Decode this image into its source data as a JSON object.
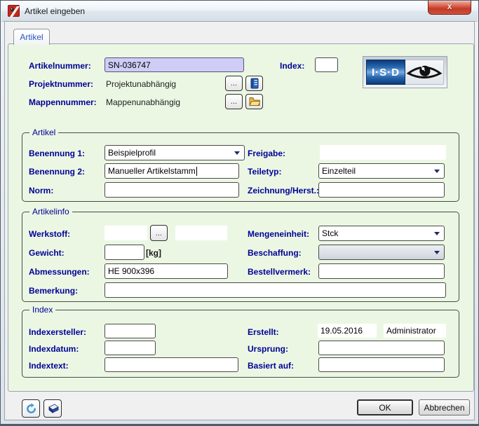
{
  "window": {
    "title": "Artikel eingeben",
    "close": "x"
  },
  "tabs": {
    "artikel": "Artikel"
  },
  "head": {
    "artikelnummer": {
      "label": "Artikelnummer:",
      "value": "SN-036747"
    },
    "index": {
      "label": "Index:",
      "value": ""
    },
    "projektnummer": {
      "label": "Projektnummer:",
      "value": "Projektunabhängig"
    },
    "mappennummer": {
      "label": "Mappennummer:",
      "value": "Mappenunabhängig"
    },
    "browse": "...",
    "logo": {
      "text": "I·S·D"
    }
  },
  "groups": {
    "artikel": {
      "title": "Artikel",
      "benennung1": {
        "label": "Benennung 1:",
        "value": "Beispielprofil"
      },
      "freigabe": {
        "label": "Freigabe:",
        "value": ""
      },
      "benennung2": {
        "label": "Benennung 2:",
        "value": "Manueller Artikelstamm"
      },
      "teiletyp": {
        "label": "Teiletyp:",
        "value": "Einzelteil"
      },
      "norm": {
        "label": "Norm:",
        "value": ""
      },
      "zeichnung": {
        "label": "Zeichnung/Herst.:",
        "value": ""
      }
    },
    "artikelinfo": {
      "title": "Artikelinfo",
      "werkstoff": {
        "label": "Werkstoff:",
        "value": "",
        "value2": ""
      },
      "browse": "...",
      "mengeneinheit": {
        "label": "Mengeneinheit:",
        "value": "Stck"
      },
      "gewicht": {
        "label": "Gewicht:",
        "value": "",
        "unit": "[kg]"
      },
      "beschaffung": {
        "label": "Beschaffung:",
        "value": ""
      },
      "abmessungen": {
        "label": "Abmessungen:",
        "value": "HE 900x396"
      },
      "bestellvermerk": {
        "label": "Bestellvermerk:",
        "value": ""
      },
      "bemerkung": {
        "label": "Bemerkung:",
        "value": ""
      }
    },
    "index": {
      "title": "Index",
      "indexersteller": {
        "label": "Indexersteller:",
        "value": ""
      },
      "erstellt": {
        "label": "Erstellt:",
        "date": "19.05.2016",
        "user": "Administrator"
      },
      "indexdatum": {
        "label": "Indexdatum:",
        "value": ""
      },
      "ursprung": {
        "label": "Ursprung:",
        "value": ""
      },
      "indextext": {
        "label": "Indextext:",
        "value": ""
      },
      "basiert_auf": {
        "label": "Basiert auf:",
        "value": ""
      }
    }
  },
  "footer": {
    "ok": "OK",
    "cancel": "Abbrechen"
  },
  "icons": {
    "app": "hicad-app",
    "project": "card-index",
    "mappe": "folder",
    "refresh": "circular-arrow",
    "eraser": "eraser",
    "logo": "isd-eye"
  },
  "colors": {
    "label_navy": "#000096",
    "panel_green": "#ebf7e3",
    "field_lavender": "#cfccf6",
    "logo_blue": "#2a6ab2",
    "close_red": "#c03a28"
  }
}
